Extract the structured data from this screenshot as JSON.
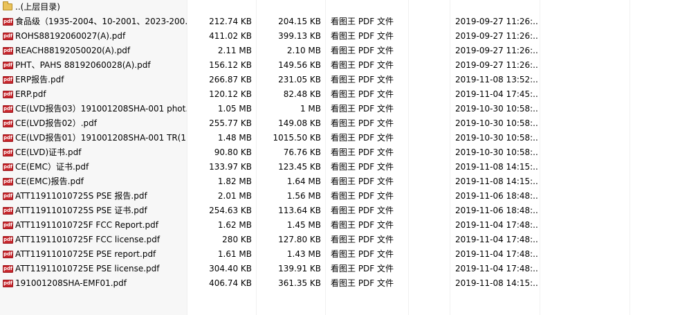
{
  "parent_folder": {
    "label": "..(上层目录)",
    "icon": "folder-icon"
  },
  "files": [
    {
      "name": "食品级（1935-2004、10-2001、2023-200...",
      "size": "212.74 KB",
      "compressed": "204.15 KB",
      "type": "看图王 PDF 文件",
      "modified": "2019-09-27 11:26:..."
    },
    {
      "name": "ROHS88192060027(A).pdf",
      "size": "411.02 KB",
      "compressed": "399.13 KB",
      "type": "看图王 PDF 文件",
      "modified": "2019-09-27 11:26:..."
    },
    {
      "name": "REACH88192050020(A).pdf",
      "size": "2.11 MB",
      "compressed": "2.10 MB",
      "type": "看图王 PDF 文件",
      "modified": "2019-09-27 11:26:..."
    },
    {
      "name": "PHT、PAHS 88192060028(A).pdf",
      "size": "156.12 KB",
      "compressed": "149.56 KB",
      "type": "看图王 PDF 文件",
      "modified": "2019-09-27 11:26:..."
    },
    {
      "name": "ERP报告.pdf",
      "size": "266.87 KB",
      "compressed": "231.05 KB",
      "type": "看图王 PDF 文件",
      "modified": "2019-11-08 13:52:..."
    },
    {
      "name": "ERP.pdf",
      "size": "120.12 KB",
      "compressed": "82.48 KB",
      "type": "看图王 PDF 文件",
      "modified": "2019-11-04 17:45:..."
    },
    {
      "name": "CE(LVD报告03）191001208SHA-001 phot...",
      "size": "1.05 MB",
      "compressed": "1 MB",
      "type": "看图王 PDF 文件",
      "modified": "2019-10-30 10:58:..."
    },
    {
      "name": "CE(LVD报告02）.pdf",
      "size": "255.77 KB",
      "compressed": "149.08 KB",
      "type": "看图王 PDF 文件",
      "modified": "2019-10-30 10:58:..."
    },
    {
      "name": "CE(LVD报告01）191001208SHA-001 TR(1...",
      "size": "1.48 MB",
      "compressed": "1015.50 KB",
      "type": "看图王 PDF 文件",
      "modified": "2019-10-30 10:58:..."
    },
    {
      "name": "CE(LVD)证书.pdf",
      "size": "90.80 KB",
      "compressed": "76.76 KB",
      "type": "看图王 PDF 文件",
      "modified": "2019-10-30 10:58:..."
    },
    {
      "name": "CE(EMC）证书.pdf",
      "size": "133.97 KB",
      "compressed": "123.45 KB",
      "type": "看图王 PDF 文件",
      "modified": "2019-11-08 14:15:..."
    },
    {
      "name": "CE(EMC)报告.pdf",
      "size": "1.82 MB",
      "compressed": "1.64 MB",
      "type": "看图王 PDF 文件",
      "modified": "2019-11-08 14:15:..."
    },
    {
      "name": "ATT11911010725S  PSE  报告.pdf",
      "size": "2.01 MB",
      "compressed": "1.56 MB",
      "type": "看图王 PDF 文件",
      "modified": "2019-11-06 18:48:..."
    },
    {
      "name": "ATT11911010725S   PSE 证书.pdf",
      "size": "254.63 KB",
      "compressed": "113.64 KB",
      "type": "看图王 PDF 文件",
      "modified": "2019-11-06 18:48:..."
    },
    {
      "name": "ATT11911010725F FCC Report.pdf",
      "size": "1.62 MB",
      "compressed": "1.45 MB",
      "type": "看图王 PDF 文件",
      "modified": "2019-11-04 17:48:..."
    },
    {
      "name": "ATT11911010725F FCC license.pdf",
      "size": "280 KB",
      "compressed": "127.80 KB",
      "type": "看图王 PDF 文件",
      "modified": "2019-11-04 17:48:..."
    },
    {
      "name": "ATT11911010725E PSE report.pdf",
      "size": "1.61 MB",
      "compressed": "1.43 MB",
      "type": "看图王 PDF 文件",
      "modified": "2019-11-04 17:48:..."
    },
    {
      "name": "ATT11911010725E PSE  license.pdf",
      "size": "304.40 KB",
      "compressed": "139.91 KB",
      "type": "看图王 PDF 文件",
      "modified": "2019-11-04 17:48:..."
    },
    {
      "name": "191001208SHA-EMF01.pdf",
      "size": "406.74 KB",
      "compressed": "361.35 KB",
      "type": "看图王 PDF 文件",
      "modified": "2019-11-08 14:15:..."
    }
  ]
}
